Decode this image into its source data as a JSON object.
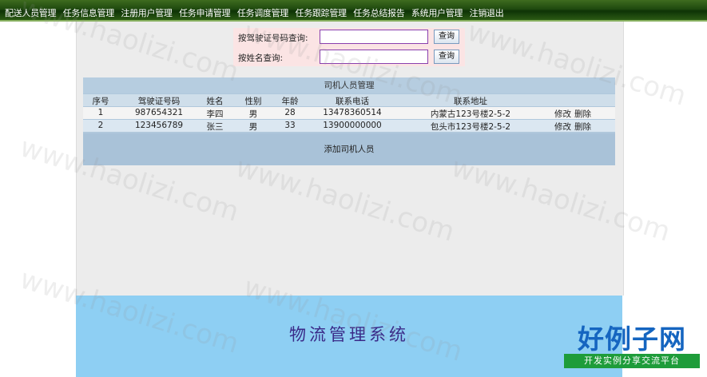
{
  "nav": {
    "items": [
      {
        "label": "配送人员管理"
      },
      {
        "label": "任务信息管理"
      },
      {
        "label": "注册用户管理"
      },
      {
        "label": "任务申请管理"
      },
      {
        "label": "任务调度管理"
      },
      {
        "label": "任务跟踪管理"
      },
      {
        "label": "任务总结报告"
      },
      {
        "label": "系统用户管理"
      },
      {
        "label": "注销退出"
      }
    ]
  },
  "search": {
    "license_label": "按驾驶证号码查询:",
    "license_value": "",
    "name_label": "按姓名查询:",
    "name_value": "",
    "query_button": "查询"
  },
  "table": {
    "title": "司机人员管理",
    "headers": [
      "序号",
      "驾驶证号码",
      "姓名",
      "性别",
      "年龄",
      "联系电话",
      "联系地址",
      ""
    ],
    "rows": [
      {
        "no": "1",
        "license": "987654321",
        "name": "李四",
        "gender": "男",
        "age": "28",
        "phone": "13478360514",
        "address": "内蒙古123号楼2-5-2",
        "edit": "修改",
        "delete": "删除"
      },
      {
        "no": "2",
        "license": "123456789",
        "name": "张三",
        "gender": "男",
        "age": "33",
        "phone": "13900000000",
        "address": "包头市123号楼2-5-2",
        "edit": "修改",
        "delete": "删除"
      }
    ],
    "add_label": "添加司机人员"
  },
  "footer": {
    "title": "物流管理系统"
  },
  "watermark": {
    "text": "www.haolizi.com",
    "logo": "好例子网",
    "slogan": "开发实例分享交流平台"
  }
}
